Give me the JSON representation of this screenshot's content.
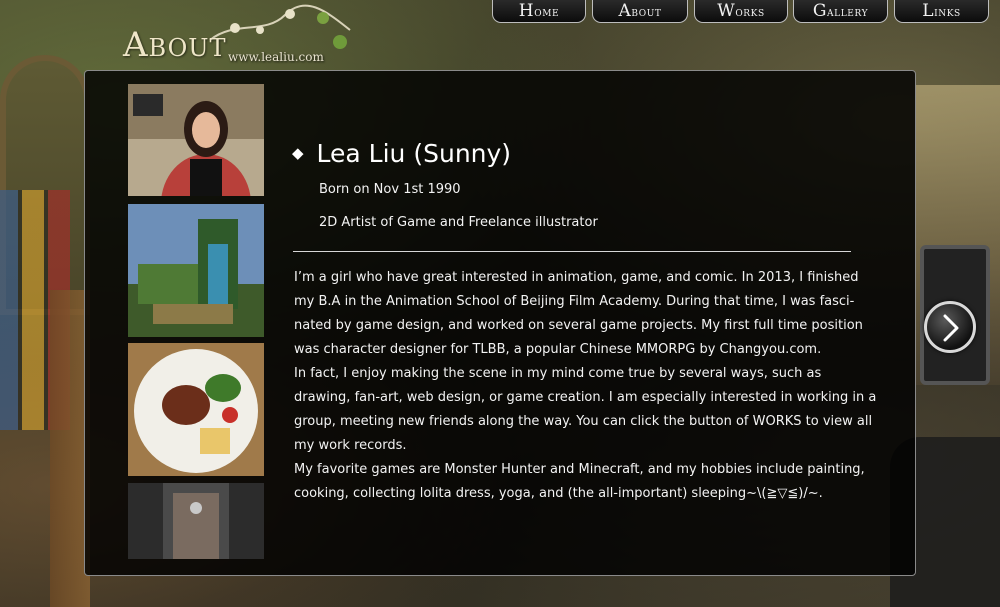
{
  "header": {
    "logo": "About",
    "url": "www.lealiu.com"
  },
  "nav": {
    "items": [
      {
        "first": "H",
        "rest": "ome"
      },
      {
        "first": "A",
        "rest": "bout"
      },
      {
        "first": "W",
        "rest": "orks"
      },
      {
        "first": "G",
        "rest": "allery"
      },
      {
        "first": "L",
        "rest": "inks"
      }
    ]
  },
  "profile": {
    "name": "Lea Liu (Sunny)",
    "born": "Born on Nov 1st 1990",
    "role": "2D Artist of Game and Freelance illustrator",
    "bio": [
      "I’m a girl who have great interested in animation, game, and comic. In 2013, I finished my B.A in the Animation School of Beijing Film Academy. During that time, I was fasci-nated by game design, and worked on several game projects. My first full time position was character designer for TLBB, a popular Chinese MMORPG by Changyou.com.",
      "In fact, I enjoy making the scene in my mind come true by several ways, such as drawing, fan-art, web design, or game creation. I am especially interested in working in a group, meeting new friends along the way. You can click the button of WORKS to view all my work records.",
      "My favorite games are Monster Hunter and Minecraft, and my hobbies include painting, cooking, collecting lolita dress, yoga, and (the all-important) sleeping~\\(≧▽≦)/~."
    ]
  },
  "icons": {
    "bullet": "diamond-bullet-icon",
    "next": "chevron-right-icon"
  },
  "colors": {
    "panel_bg": "#000000",
    "text": "#f3f3f3",
    "nav_border": "#bdbdbd"
  }
}
